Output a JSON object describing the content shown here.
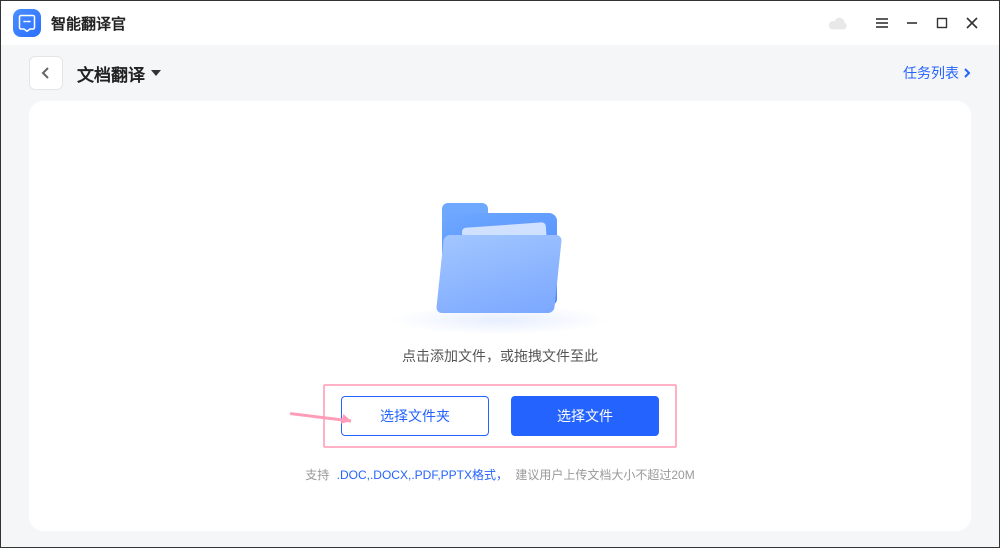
{
  "app": {
    "title": "智能翻译官"
  },
  "nav": {
    "page_name": "文档翻译",
    "task_list_label": "任务列表"
  },
  "dropzone": {
    "hint_add": "点击添加文件，",
    "hint_drag": "或拖拽文件至此",
    "select_folder_btn": "选择文件夹",
    "select_file_btn": "选择文件",
    "support_prefix": "支持",
    "support_formats": ".DOC,.DOCX,.PDF,PPTX格式，",
    "support_suffix": "建议用户上传文档大小不超过20M"
  }
}
